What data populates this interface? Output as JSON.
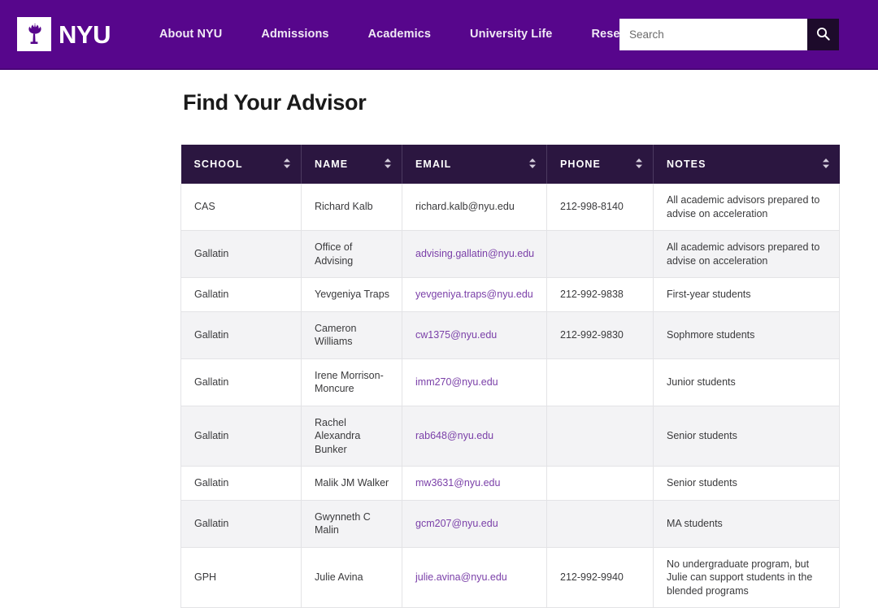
{
  "header": {
    "brand_name": "NYU",
    "logo_icon": "nyu-torch-icon",
    "nav": [
      {
        "label": "About NYU"
      },
      {
        "label": "Admissions"
      },
      {
        "label": "Academics"
      },
      {
        "label": "University Life"
      },
      {
        "label": "Research"
      }
    ],
    "search": {
      "value": "",
      "placeholder": "Search",
      "button_icon": "search-icon"
    },
    "colors": {
      "bar": "#57068c",
      "search_button": "#1d0b2b"
    }
  },
  "main": {
    "page_title": "Find Your Advisor"
  },
  "table": {
    "sort_icon": "sort-updown-icon",
    "header_color": "#2b1640",
    "link_color": "#7a3fa8",
    "columns": [
      {
        "label": "SCHOOL",
        "sortable": true
      },
      {
        "label": "NAME",
        "sortable": true
      },
      {
        "label": "EMAIL",
        "sortable": true
      },
      {
        "label": "PHONE",
        "sortable": true
      },
      {
        "label": "NOTES",
        "sortable": true
      }
    ],
    "rows": [
      {
        "school": "CAS",
        "name": "Richard Kalb",
        "email": "richard.kalb@nyu.edu",
        "email_is_link": false,
        "phone": "212-998-8140",
        "notes": "All academic advisors  prepared to advise on acceleration"
      },
      {
        "school": "Gallatin",
        "name": "Office of Advising",
        "email": "advising.gallatin@nyu.edu",
        "email_is_link": true,
        "phone": "",
        "notes": "All academic advisors  prepared to advise on acceleration"
      },
      {
        "school": "Gallatin",
        "name": "Yevgeniya Traps",
        "email": "yevgeniya.traps@nyu.edu",
        "email_is_link": true,
        "phone": "212-992-9838",
        "notes": "First-year students"
      },
      {
        "school": "Gallatin",
        "name": "Cameron Williams",
        "email": "cw1375@nyu.edu",
        "email_is_link": true,
        "phone": "212-992-9830",
        "notes": "Sophmore students"
      },
      {
        "school": "Gallatin",
        "name": "Irene Morrison-Moncure",
        "email": "imm270@nyu.edu",
        "email_is_link": true,
        "phone": "",
        "notes": "Junior students"
      },
      {
        "school": "Gallatin",
        "name": "Rachel Alexandra Bunker",
        "email": "rab648@nyu.edu",
        "email_is_link": true,
        "phone": "",
        "notes": "Senior students"
      },
      {
        "school": "Gallatin",
        "name": "Malik JM Walker",
        "email": "mw3631@nyu.edu",
        "email_is_link": true,
        "phone": "",
        "notes": "Senior students"
      },
      {
        "school": "Gallatin",
        "name": "Gwynneth C Malin",
        "email": "gcm207@nyu.edu",
        "email_is_link": true,
        "phone": "",
        "notes": "MA students"
      },
      {
        "school": "GPH",
        "name": "Julie Avina",
        "email": "julie.avina@nyu.edu",
        "email_is_link": true,
        "phone": "212-992-9940",
        "notes": "No undergraduate program, but Julie can support students in the blended programs"
      }
    ]
  }
}
